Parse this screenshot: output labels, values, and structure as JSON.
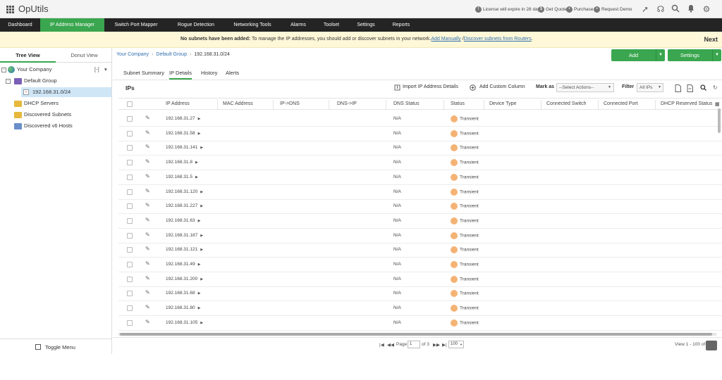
{
  "app": {
    "title": "OpUtils"
  },
  "topbar": {
    "license_text": "License will expire in 28 days",
    "get_quote": "Get Quote",
    "purchase": "Purchase",
    "request_demo": "Request Demo"
  },
  "nav": {
    "items": [
      {
        "label": "Dashboard"
      },
      {
        "label": "IP Address Manager"
      },
      {
        "label": "Switch Port Mapper"
      },
      {
        "label": "Rogue Detection"
      },
      {
        "label": "Networking Tools"
      },
      {
        "label": "Alarms"
      },
      {
        "label": "Toolset"
      },
      {
        "label": "Settings"
      },
      {
        "label": "Reports"
      }
    ],
    "active_index": 1
  },
  "banner": {
    "bold_text": "No subnets have been added:",
    "text": " To manage the IP addresses, you should add or discover subnets in your network.",
    "link_add": "Add Manually",
    "separator": " /",
    "link_discover": "Discover subnets from Routers",
    "trailing": ".",
    "next": "Next"
  },
  "sidebar": {
    "tabs": [
      {
        "label": "Tree View"
      },
      {
        "label": "Donut View"
      }
    ],
    "tree": {
      "root": "Your Company",
      "collapse_control": "[-]",
      "items": [
        {
          "label": "Default Group"
        },
        {
          "label": "192.168.31.0/24"
        },
        {
          "label": "DHCP Servers"
        },
        {
          "label": "Discovered Subnets"
        },
        {
          "label": "Discovered v6 Hosts"
        }
      ]
    },
    "toggle_menu": "Toggle Menu"
  },
  "breadcrumb": {
    "items": [
      "Your Company",
      "Default Group",
      "192.168.31.0/24"
    ],
    "separator": "›"
  },
  "actions": {
    "add": "Add",
    "settings": "Settings"
  },
  "subtabs": [
    {
      "label": "Subnet Summary"
    },
    {
      "label": "IP Details"
    },
    {
      "label": "History"
    },
    {
      "label": "Alerts"
    }
  ],
  "toolbar": {
    "section_title": "IPs",
    "import": "Import IP Address Details",
    "add_column": "Add Custom Column",
    "mark_as_label": "Mark as",
    "mark_as_value": "--Select Actions--",
    "filter_label": "Filter",
    "filter_value": "All IPs"
  },
  "table": {
    "columns": [
      "IP Address",
      "MAC Address",
      "IP->DNS",
      "DNS->IP",
      "DNS Status",
      "Status",
      "Device Type",
      "Connected Switch",
      "Connected Port",
      "DHCP Reserved Status"
    ],
    "rows": [
      {
        "ip": "192.168.31.27",
        "dns_status": "N/A",
        "status": "Transient"
      },
      {
        "ip": "192.168.31.58",
        "dns_status": "N/A",
        "status": "Transient"
      },
      {
        "ip": "192.168.31.141",
        "dns_status": "N/A",
        "status": "Transient"
      },
      {
        "ip": "192.168.31.8",
        "dns_status": "N/A",
        "status": "Transient"
      },
      {
        "ip": "192.168.31.5",
        "dns_status": "N/A",
        "status": "Transient"
      },
      {
        "ip": "192.168.31.120",
        "dns_status": "N/A",
        "status": "Transient"
      },
      {
        "ip": "192.168.31.227",
        "dns_status": "N/A",
        "status": "Transient"
      },
      {
        "ip": "192.168.31.63",
        "dns_status": "N/A",
        "status": "Transient"
      },
      {
        "ip": "192.168.31.187",
        "dns_status": "N/A",
        "status": "Transient"
      },
      {
        "ip": "192.168.31.121",
        "dns_status": "N/A",
        "status": "Transient"
      },
      {
        "ip": "192.168.31.49",
        "dns_status": "N/A",
        "status": "Transient"
      },
      {
        "ip": "192.168.31.200",
        "dns_status": "N/A",
        "status": "Transient"
      },
      {
        "ip": "192.168.31.68",
        "dns_status": "N/A",
        "status": "Transient"
      },
      {
        "ip": "192.168.31.80",
        "dns_status": "N/A",
        "status": "Transient"
      },
      {
        "ip": "192.168.31.105",
        "dns_status": "N/A",
        "status": "Transient"
      }
    ]
  },
  "pager": {
    "page_label": "Page",
    "page_value": "1",
    "of_label": "of 3",
    "per_page": "100",
    "view_text": "View 1 - 100 of 254"
  },
  "colors": {
    "accent_green": "#3aa64f",
    "nav_bg": "#242424",
    "banner_bg": "#fff8d8",
    "transient": "#f4b375",
    "link": "#2e6fb0"
  }
}
